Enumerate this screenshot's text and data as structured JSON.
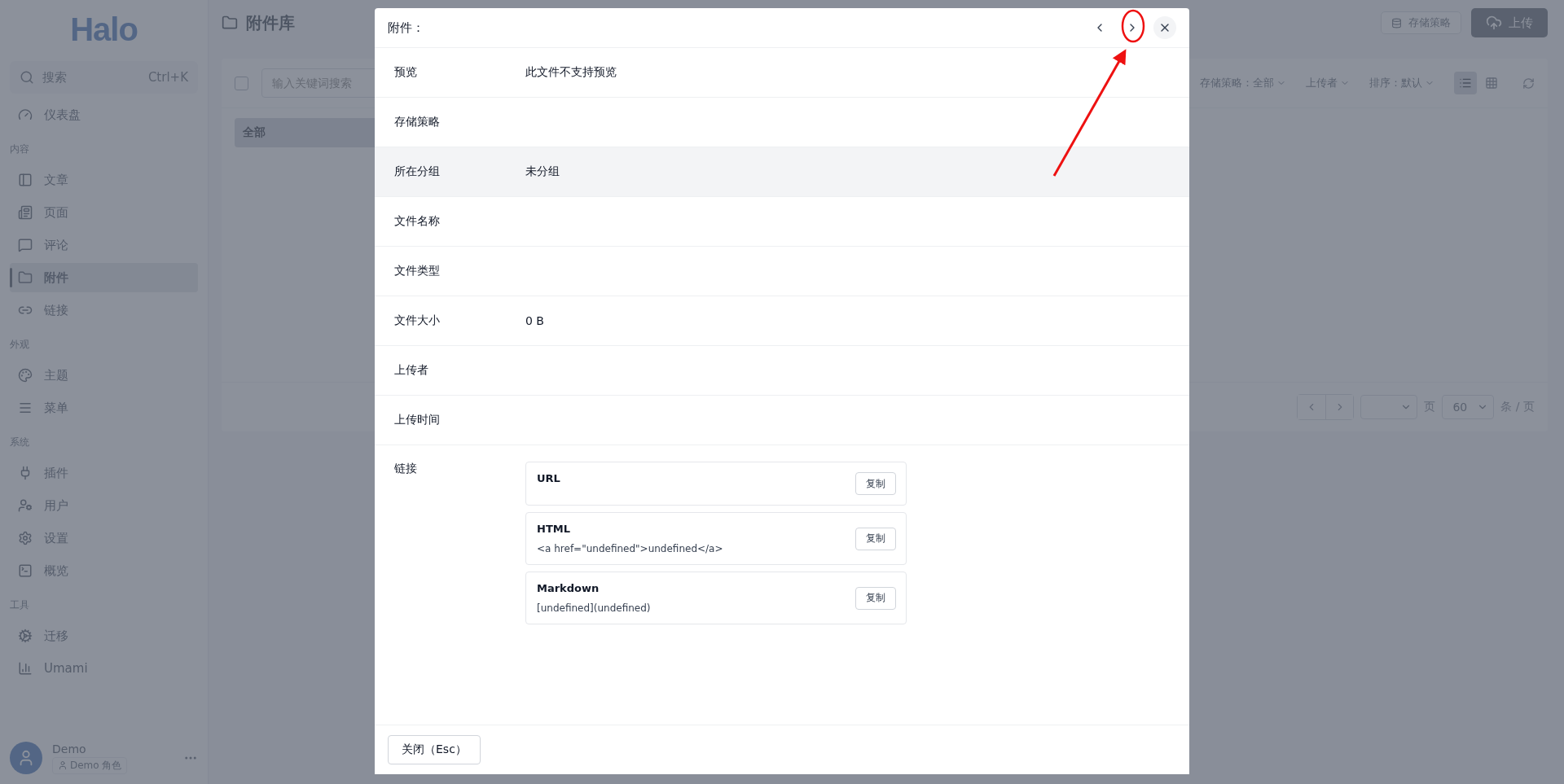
{
  "sidebar": {
    "logo": "Halo",
    "search": {
      "placeholder": "搜索",
      "shortcut": "Ctrl+K"
    },
    "sections": [
      {
        "items": [
          {
            "label": "仪表盘",
            "selected": false
          }
        ]
      },
      {
        "title": "内容",
        "items": [
          {
            "label": "文章",
            "selected": false
          },
          {
            "label": "页面",
            "selected": false
          },
          {
            "label": "评论",
            "selected": false
          },
          {
            "label": "附件",
            "selected": true
          },
          {
            "label": "链接",
            "selected": false
          }
        ]
      },
      {
        "title": "外观",
        "items": [
          {
            "label": "主题",
            "selected": false
          },
          {
            "label": "菜单",
            "selected": false
          }
        ]
      },
      {
        "title": "系统",
        "items": [
          {
            "label": "插件",
            "selected": false
          },
          {
            "label": "用户",
            "selected": false
          },
          {
            "label": "设置",
            "selected": false
          },
          {
            "label": "概览",
            "selected": false
          }
        ]
      },
      {
        "title": "工具",
        "items": [
          {
            "label": "迁移",
            "selected": false
          },
          {
            "label": "Umami",
            "selected": false
          }
        ]
      }
    ],
    "user": {
      "name": "Demo",
      "role": "Demo 角色"
    }
  },
  "header": {
    "title": "附件库",
    "buttons": [
      {
        "label": "存储策略",
        "kind": "outline"
      },
      {
        "label": "上传",
        "kind": "primary"
      }
    ]
  },
  "toolbar": {
    "checked": false,
    "search_placeholder": "输入关键词搜索",
    "filters": [
      "存储策略：全部",
      "上传者",
      "排序：默认"
    ],
    "views": [
      {
        "selected": true
      },
      {
        "selected": false
      }
    ]
  },
  "groups": [
    {
      "label": "全部",
      "selected": true
    }
  ],
  "pagination": {
    "page_unit": "页",
    "page_size": "60",
    "size_unit": "条 / 页"
  },
  "modal": {
    "title": "附件：",
    "fields": [
      {
        "label": "预览",
        "value": "此文件不支持预览",
        "highlighted": false
      },
      {
        "label": "存储策略",
        "highlighted": false
      },
      {
        "label": "所在分组",
        "value": "未分组",
        "highlighted": true
      },
      {
        "label": "文件名称",
        "highlighted": false
      },
      {
        "label": "文件类型",
        "highlighted": false
      },
      {
        "label": "文件大小",
        "value": "0 B",
        "highlighted": false
      },
      {
        "label": "上传者",
        "highlighted": false
      },
      {
        "label": "上传时间",
        "highlighted": false
      }
    ],
    "links": {
      "label": "链接",
      "items": [
        {
          "title": "URL",
          "button": "复制"
        },
        {
          "title": "HTML",
          "value": "<a href=\"undefined\">undefined</a>",
          "button": "复制"
        },
        {
          "title": "Markdown",
          "value": "[undefined](undefined)",
          "button": "复制"
        }
      ]
    },
    "close_button": "关闭（Esc）"
  }
}
